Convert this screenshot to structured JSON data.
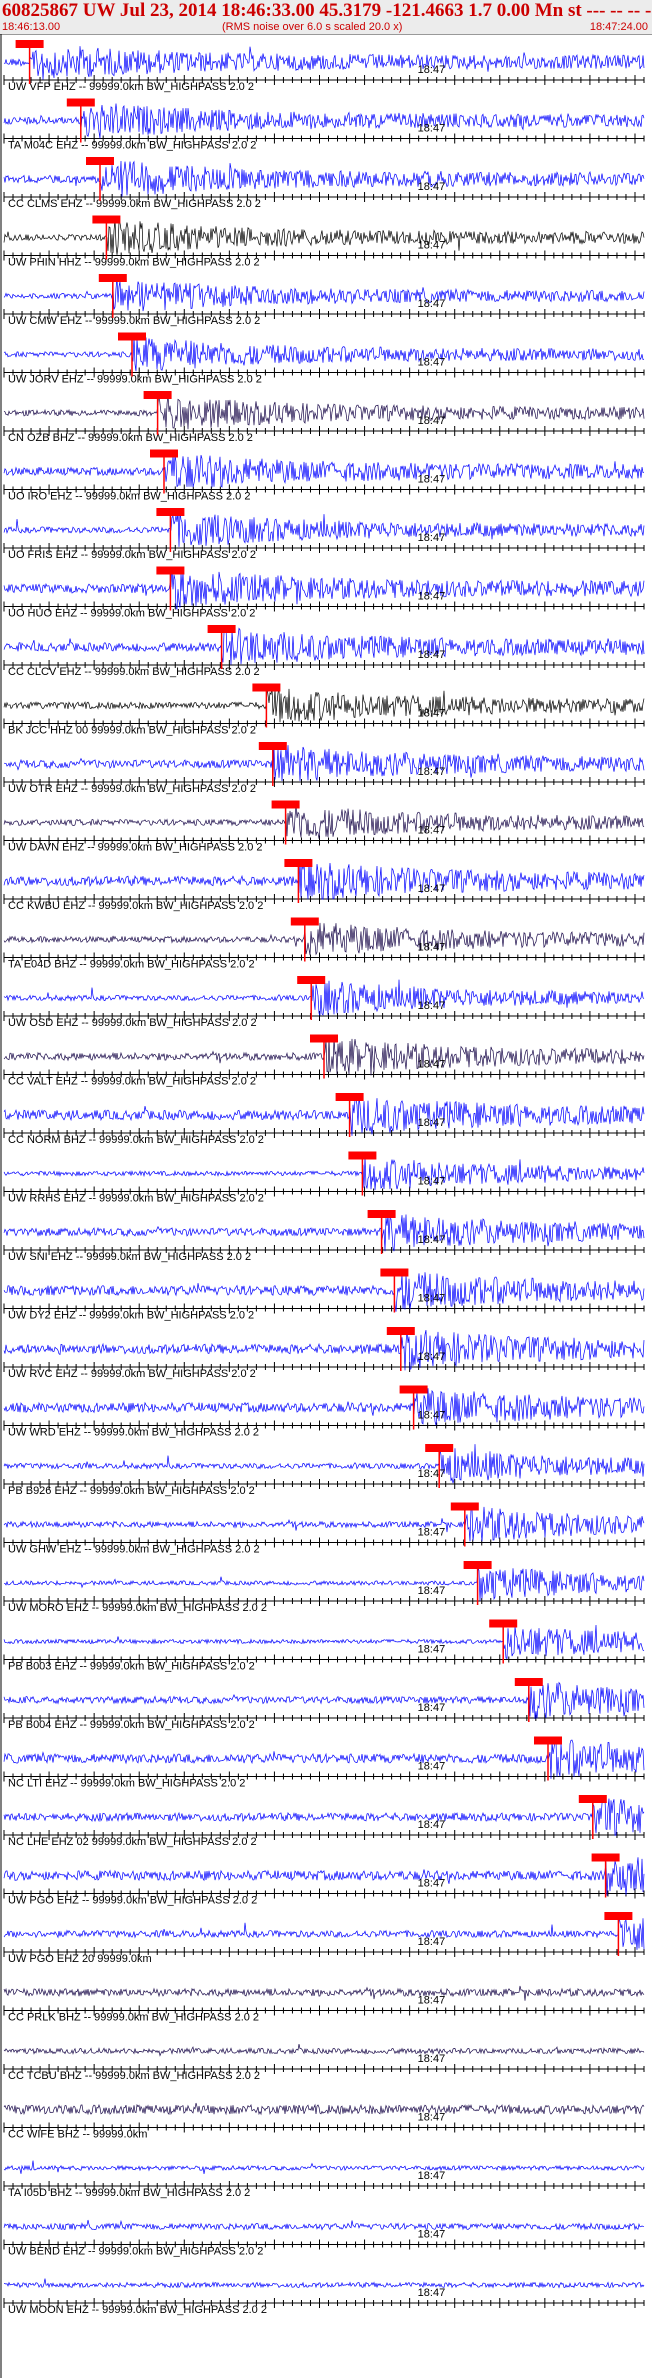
{
  "header": {
    "title": "60825867 UW Jul 23, 2014 18:46:33.00   45.3179 -121.4663  1.7 0.00 Mn st --- -- --  -1",
    "start_time": "18:46:13.00",
    "noise_note": "(RMS noise over 6.0 s scaled 20.0 x)",
    "end_time": "18:47:24.00"
  },
  "colors": {
    "trace_blue": "#0000ff",
    "trace_black": "#000000",
    "trace_navy": "#1a0a4a",
    "pick_red": "#ff0000",
    "tick_black": "#000000"
  },
  "chart_data": {
    "type": "line",
    "time_axis": {
      "start": "18:46:13.00",
      "end": "18:47:24.00",
      "minute_tick_label": "18:47"
    },
    "traces": [
      {
        "label": "UW VFP EHZ -- 99999.0km BW_HIGHPASS  2.0  2",
        "color": "blue",
        "pick": 0.04,
        "tick": "18:47"
      },
      {
        "label": "TA M04C EHZ -- 99999.0km BW_HIGHPASS  2.0  2",
        "color": "blue",
        "pick": 0.12,
        "tick": "18:47"
      },
      {
        "label": "CC CLMS EHZ -- 99999.0km BW_HIGHPASS  2.0  2",
        "color": "blue",
        "pick": 0.15,
        "tick": "18:47"
      },
      {
        "label": "UW PHIN HHZ -- 99999.0km BW_HIGHPASS  2.0  2",
        "color": "black",
        "pick": 0.16,
        "tick": "18:47"
      },
      {
        "label": "UW CMW EHZ -- 99999.0km BW_HIGHPASS  2.0  2",
        "color": "blue",
        "pick": 0.17,
        "tick": "18:47"
      },
      {
        "label": "UW JORV EHZ -- 99999.0km BW_HIGHPASS  2.0  2",
        "color": "blue",
        "pick": 0.2,
        "tick": "18:47"
      },
      {
        "label": "CN OZB BHZ -- 99999.0km BW_HIGHPASS  2.0  2",
        "color": "navy",
        "pick": 0.24,
        "tick": "18:47"
      },
      {
        "label": "UO IRO EHZ -- 99999.0km BW_HIGHPASS  2.0  2",
        "color": "blue",
        "pick": 0.25,
        "tick": "18:47"
      },
      {
        "label": "UO FRIS EHZ -- 99999.0km BW_HIGHPASS  2.0  2",
        "color": "blue",
        "pick": 0.26,
        "tick": "18:47"
      },
      {
        "label": "UO HUO EHZ -- 99999.0km BW_HIGHPASS  2.0  2",
        "color": "blue",
        "pick": 0.26,
        "tick": "18:47"
      },
      {
        "label": "CC CLCV EHZ -- 99999.0km BW_HIGHPASS  2.0  2",
        "color": "blue",
        "pick": 0.34,
        "tick": "18:47"
      },
      {
        "label": "BK JCC HHZ 00 99999.0km BW_HIGHPASS  2.0  2",
        "color": "black",
        "pick": 0.41,
        "tick": "18:47"
      },
      {
        "label": "UW OTR EHZ -- 99999.0km BW_HIGHPASS  2.0  2",
        "color": "blue",
        "pick": 0.42,
        "tick": "18:47"
      },
      {
        "label": "UW DAVN EHZ -- 99999.0km BW_HIGHPASS  2.0  2",
        "color": "navy",
        "pick": 0.44,
        "tick": "18:47"
      },
      {
        "label": "CC KWBU EHZ -- 99999.0km BW_HIGHPASS  2.0  2",
        "color": "blue",
        "pick": 0.46,
        "tick": "18:47"
      },
      {
        "label": "TA E04D BHZ -- 99999.0km BW_HIGHPASS  2.0  2",
        "color": "navy",
        "pick": 0.47,
        "tick": "18:47"
      },
      {
        "label": "UW OSD EHZ -- 99999.0km BW_HIGHPASS  2.0  2",
        "color": "blue",
        "pick": 0.48,
        "tick": "18:47"
      },
      {
        "label": "CC VALT EHZ -- 99999.0km BW_HIGHPASS  2.0  2",
        "color": "navy",
        "pick": 0.5,
        "tick": "18:47"
      },
      {
        "label": "CC NORM BHZ -- 99999.0km BW_HIGHPASS  2.0  2",
        "color": "blue",
        "pick": 0.54,
        "tick": "18:47"
      },
      {
        "label": "UW RRHS EHZ -- 99999.0km BW_HIGHPASS  2.0  2",
        "color": "blue",
        "pick": 0.56,
        "tick": "18:47"
      },
      {
        "label": "UW SNI EHZ -- 99999.0km BW_HIGHPASS  2.0  2",
        "color": "blue",
        "pick": 0.59,
        "tick": "18:47"
      },
      {
        "label": "UW DY2 EHZ -- 99999.0km BW_HIGHPASS  2.0  2",
        "color": "blue",
        "pick": 0.61,
        "tick": "18:47"
      },
      {
        "label": "UW RVC EHZ -- 99999.0km BW_HIGHPASS  2.0  2",
        "color": "blue",
        "pick": 0.62,
        "tick": "18:47"
      },
      {
        "label": "UW WRD EHZ -- 99999.0km BW_HIGHPASS  2.0  2",
        "color": "blue",
        "pick": 0.64,
        "tick": "18:47"
      },
      {
        "label": "PB B926 EHZ -- 99999.0km BW_HIGHPASS  2.0  2",
        "color": "blue",
        "pick": 0.68,
        "tick": "18:47"
      },
      {
        "label": "UW GHW EHZ -- 99999.0km BW_HIGHPASS  2.0  2",
        "color": "blue",
        "pick": 0.72,
        "tick": "18:47"
      },
      {
        "label": "UW MORO EHZ -- 99999.0km BW_HIGHPASS  2.0  2",
        "color": "blue",
        "pick": 0.74,
        "tick": "18:47"
      },
      {
        "label": "PB B003 EHZ -- 99999.0km BW_HIGHPASS  2.0  2",
        "color": "blue",
        "pick": 0.78,
        "tick": "18:47"
      },
      {
        "label": "PB B004 EHZ -- 99999.0km BW_HIGHPASS  2.0  2",
        "color": "blue",
        "pick": 0.82,
        "tick": "18:47"
      },
      {
        "label": "NC LTI EHZ -- 99999.0km BW_HIGHPASS  2.0  2",
        "color": "blue",
        "pick": 0.85,
        "tick": "18:47"
      },
      {
        "label": "NC LHE EHZ 02 99999.0km BW_HIGHPASS  2.0  2",
        "color": "blue",
        "pick": 0.92,
        "tick": "18:47"
      },
      {
        "label": "UW PGO EHZ -- 99999.0km BW_HIGHPASS  2.0  2",
        "color": "blue",
        "pick": 0.94,
        "tick": "18:47"
      },
      {
        "label": "UW PGO EHZ 20 99999.0km",
        "color": "blue",
        "pick": 0.96,
        "tick": "18:47"
      },
      {
        "label": "CC PRLK BHZ -- 99999.0km BW_HIGHPASS  2.0  2",
        "color": "navy",
        "pick": null,
        "tick": "18:47"
      },
      {
        "label": "CC TCBU BHZ -- 99999.0km BW_HIGHPASS  2.0  2",
        "color": "navy",
        "pick": null,
        "tick": "18:47"
      },
      {
        "label": "CC WIFE BHZ -- 99999.0km",
        "color": "navy",
        "pick": null,
        "tick": "18:47"
      },
      {
        "label": "TA I05D BHZ -- 99999.0km BW_HIGHPASS  2.0  2",
        "color": "blue",
        "pick": null,
        "tick": "18:47"
      },
      {
        "label": "UW BEND EHZ -- 99999.0km BW_HIGHPASS  2.0  2",
        "color": "blue",
        "pick": null,
        "tick": "18:47"
      },
      {
        "label": "UW MOON EHZ -- 99999.0km BW_HIGHPASS  2.0  2",
        "color": "blue",
        "pick": null,
        "tick": "18:47"
      }
    ]
  }
}
